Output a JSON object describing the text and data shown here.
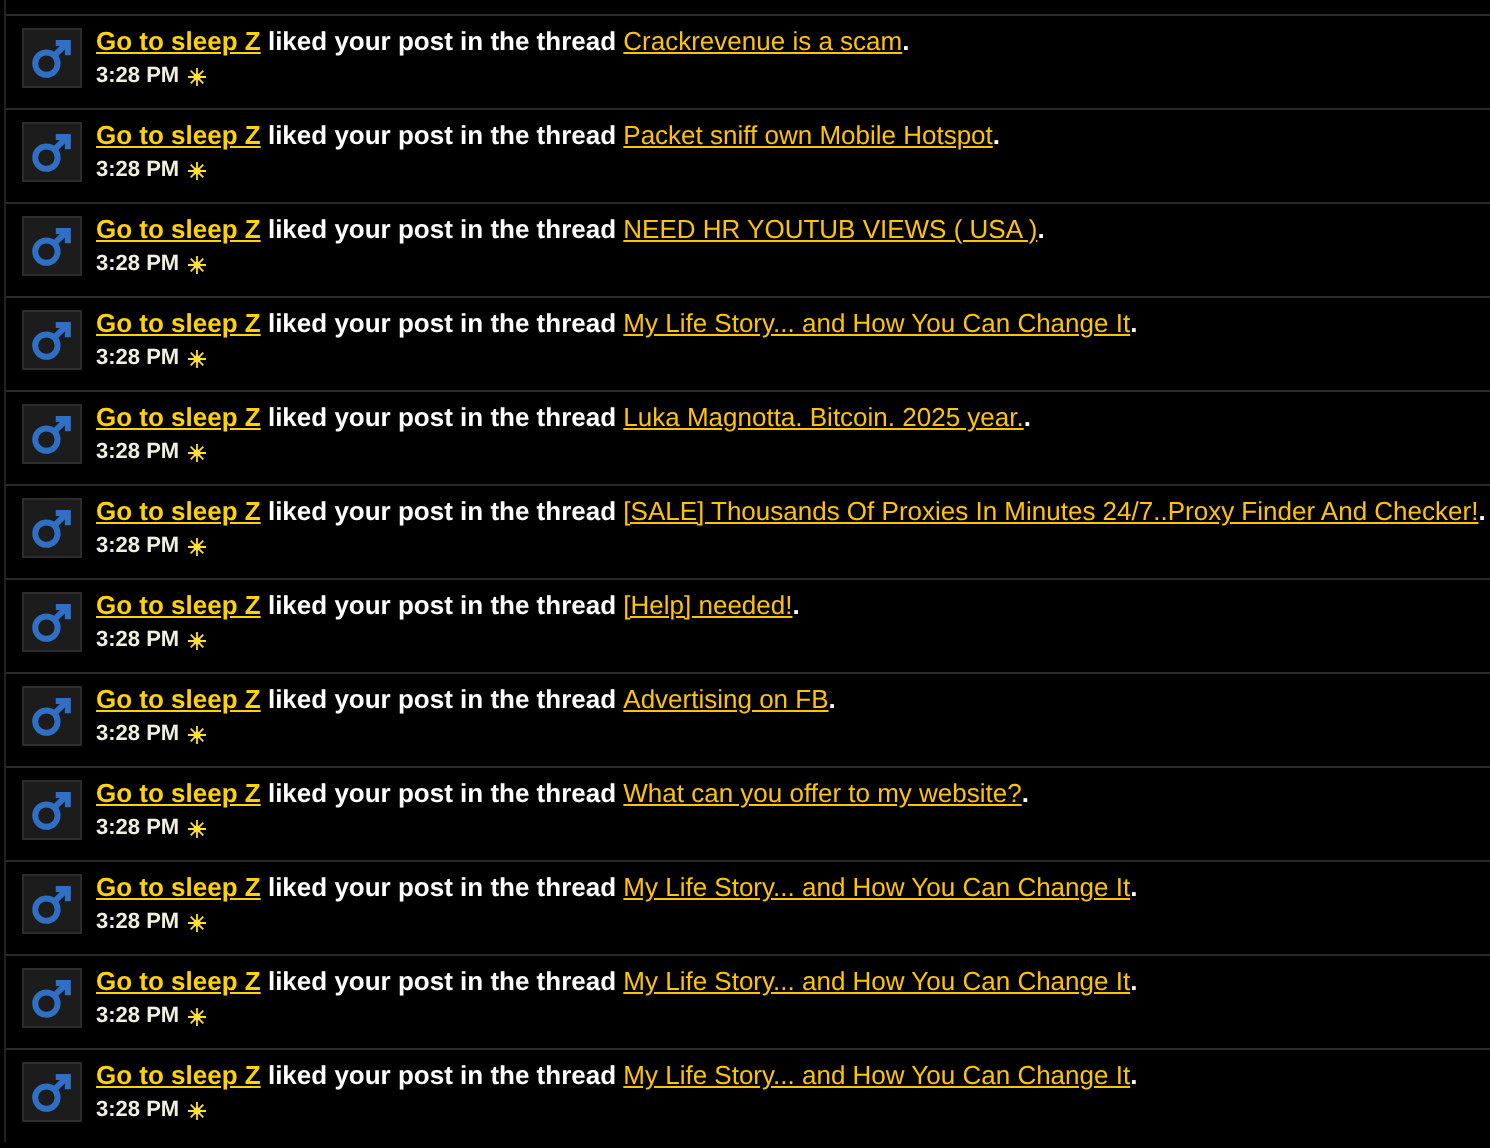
{
  "notifications": [
    {
      "user": "Go to sleep Z",
      "action": "liked your post in the thread",
      "thread": "Crackrevenue is a scam",
      "end": ".",
      "time": "3:28 PM"
    },
    {
      "user": "Go to sleep Z",
      "action": "liked your post in the thread",
      "thread": "Packet sniff own Mobile Hotspot",
      "end": ".",
      "time": "3:28 PM"
    },
    {
      "user": "Go to sleep Z",
      "action": "liked your post in the thread",
      "thread": "NEED HR YOUTUB VIEWS ( USA )",
      "end": ".",
      "time": "3:28 PM"
    },
    {
      "user": "Go to sleep Z",
      "action": "liked your post in the thread",
      "thread": "My Life Story... and How You Can Change It",
      "end": ".",
      "time": "3:28 PM"
    },
    {
      "user": "Go to sleep Z",
      "action": "liked your post in the thread",
      "thread": "Luka Magnotta. Bitcoin. 2025 year.",
      "end": ".",
      "time": "3:28 PM"
    },
    {
      "user": "Go to sleep Z",
      "action": "liked your post in the thread",
      "thread": "[SALE] Thousands Of Proxies In Minutes 24/7..Proxy Finder And Checker!",
      "end": ".",
      "time": "3:28 PM"
    },
    {
      "user": "Go to sleep Z",
      "action": "liked your post in the thread",
      "thread": "[Help] needed!",
      "end": ".",
      "time": "3:28 PM"
    },
    {
      "user": "Go to sleep Z",
      "action": "liked your post in the thread",
      "thread": "Advertising on FB",
      "end": ".",
      "time": "3:28 PM"
    },
    {
      "user": "Go to sleep Z",
      "action": "liked your post in the thread",
      "thread": "What can you offer to my website?",
      "end": ".",
      "time": "3:28 PM"
    },
    {
      "user": "Go to sleep Z",
      "action": "liked your post in the thread",
      "thread": "My Life Story... and How You Can Change It",
      "end": ".",
      "time": "3:28 PM"
    },
    {
      "user": "Go to sleep Z",
      "action": "liked your post in the thread",
      "thread": "My Life Story... and How You Can Change It",
      "end": ".",
      "time": "3:28 PM"
    },
    {
      "user": "Go to sleep Z",
      "action": "liked your post in the thread",
      "thread": "My Life Story... and How You Can Change It",
      "end": ".",
      "time": "3:28 PM"
    }
  ]
}
